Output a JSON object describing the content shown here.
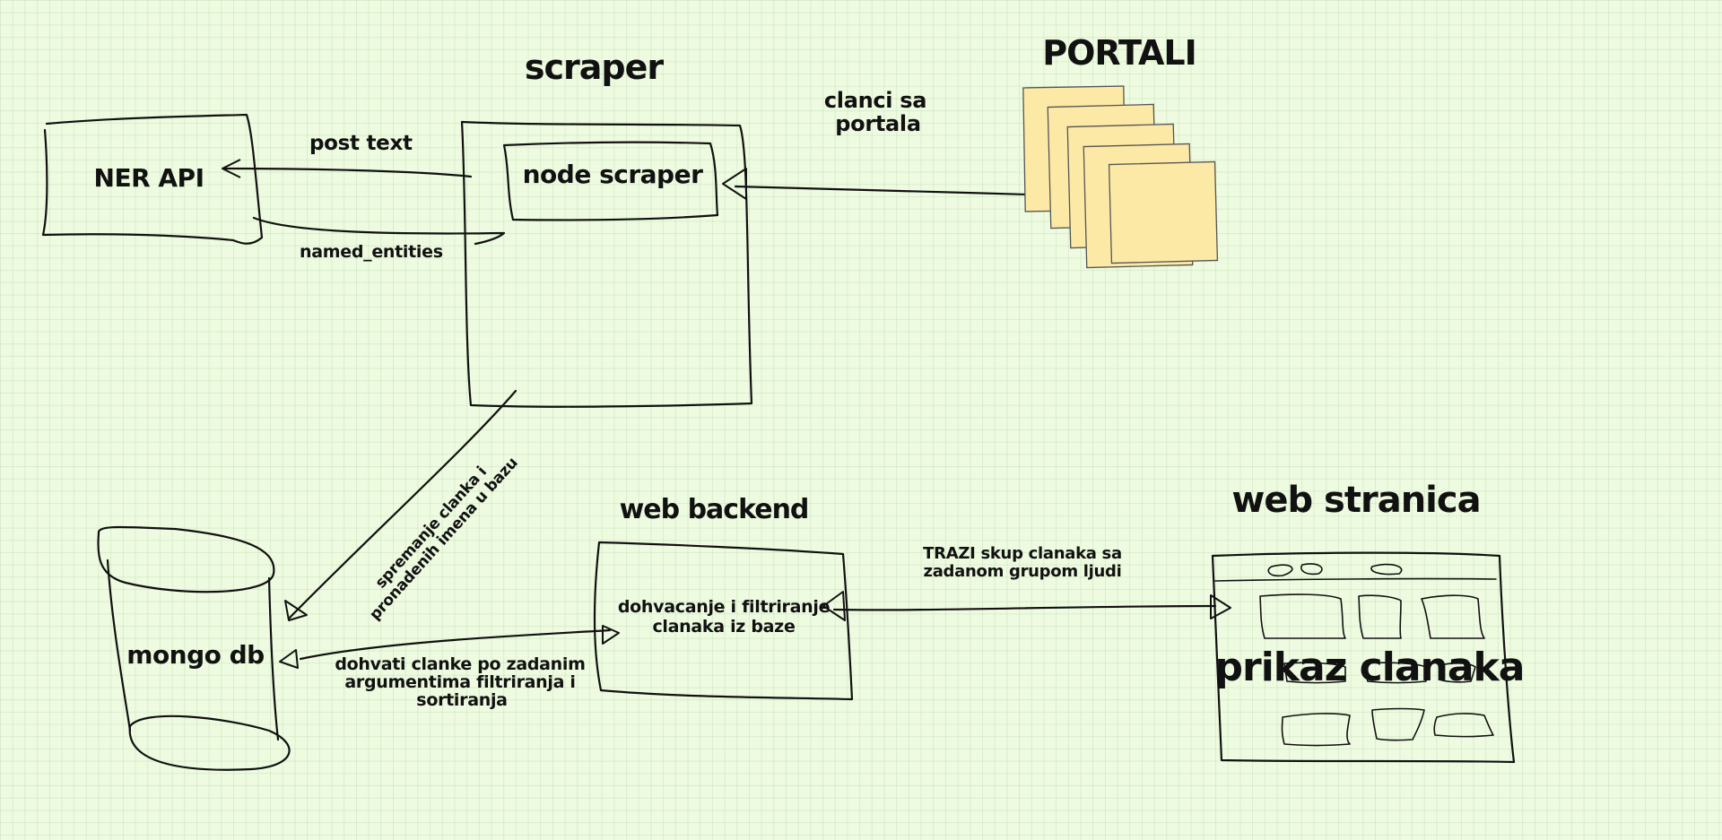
{
  "titles": {
    "scraper": "scraper",
    "portali": "PORTALI",
    "web_backend": "web backend",
    "web_stranica": "web stranica"
  },
  "boxes": {
    "ner_api": "NER API",
    "node_scraper": "node scraper",
    "mongo_db": "mongo db",
    "backend_desc_line1": "dohvacanje i filtriranje",
    "backend_desc_line2": "clanaka iz baze",
    "web_page_content": "prikaz  clanaka"
  },
  "edges": {
    "post_text": "post text",
    "named_entities": "named_entities",
    "clanci_line1": "clanci sa",
    "clanci_line2": "portala",
    "spremanje_line1": "spremanje clanka i",
    "spremanje_line2": "pronadenih imena u bazu",
    "dohvati_line1": "dohvati clanke po zadanim",
    "dohvati_line2": "argumentima filtriranja i",
    "dohvati_line3": "sortiranja",
    "trazi_line1": "TRAZI skup clanaka sa",
    "trazi_line2": "zadanom grupom ljudi"
  },
  "colors": {
    "background": "#eefbe0",
    "sticky_note": "#fde9a6",
    "ink": "#111111"
  }
}
